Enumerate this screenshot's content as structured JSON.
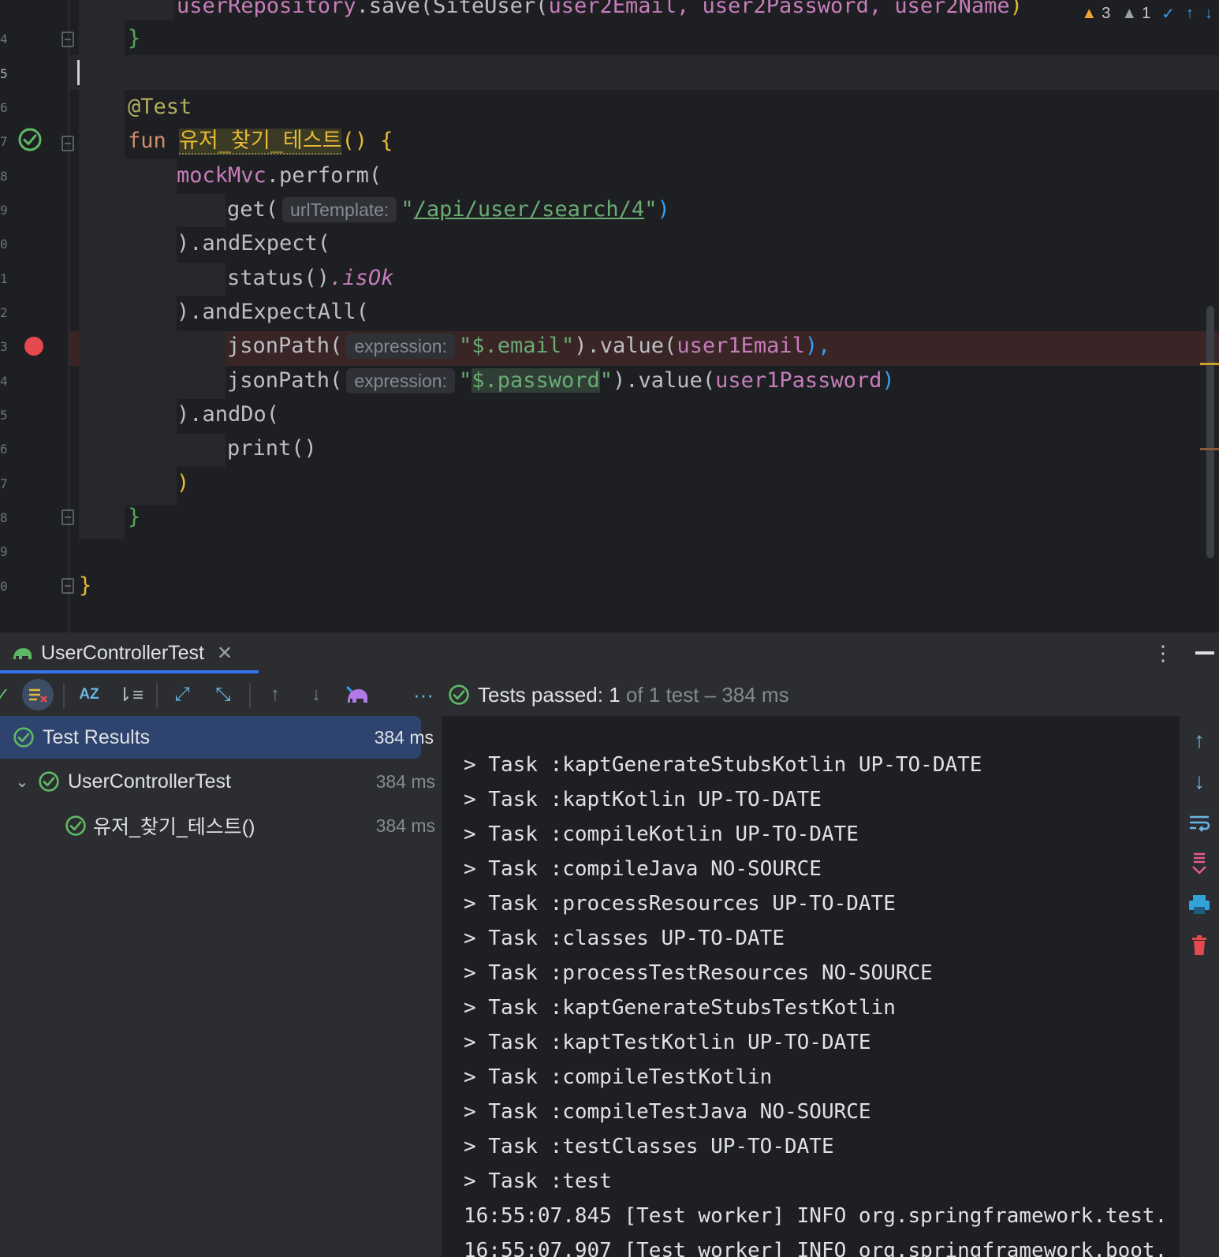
{
  "editor": {
    "top_partial": {
      "receiver": "userRepository",
      "method": ".save(",
      "ctor": "SiteUser(",
      "args": "user2Email, user2Password, user2Name",
      "close": ")"
    },
    "warnings": {
      "warn_count": "3",
      "weak_count": "1"
    },
    "lines": {
      "brace_close_1": "}",
      "annotation": "@Test",
      "fun_kw": "fun",
      "fun_name": "유저_찾기_테스트",
      "fun_sig_tail": "() {",
      "mockmvc": "mockMvc",
      "perform": ".perform(",
      "get": "get(",
      "get_hint": "urlTemplate:",
      "get_url": "/api/user/search/4",
      "get_close": ")",
      "and_expect": ").andExpect(",
      "status": "status()",
      "is_ok": ".isOk",
      "and_expect_all": ").andExpectAll(",
      "jsonpath": "jsonPath(",
      "expr_hint": "expression:",
      "email_path": "$.email",
      "email_value": ").value(",
      "email_arg": "user1Email",
      "email_end": "),",
      "password_path": "$.password",
      "password_value": ").value(",
      "password_arg": "user1Password",
      "password_end": ")",
      "and_do": ").andDo(",
      "print": "print()",
      "paren_close": ")",
      "brace_close_2": "}",
      "brace_close_class": "}"
    },
    "line_numbers": [
      "4",
      "5",
      "6",
      "7",
      "8",
      "9",
      "0",
      "1",
      "2",
      "3",
      "4",
      "5",
      "6",
      "7",
      "8",
      "9",
      "0"
    ]
  },
  "run_panel": {
    "tab_title": "UserControllerTest",
    "status_prefix": "Tests passed:",
    "status_count": "1",
    "status_suffix": "of 1 test – 384 ms",
    "tree": [
      {
        "label": "Test Results",
        "duration": "384 ms"
      },
      {
        "label": "UserControllerTest",
        "duration": "384 ms"
      },
      {
        "label": "유저_찾기_테스트()",
        "duration": "384 ms"
      }
    ],
    "console_lines": [
      "> Task :kaptGenerateStubsKotlin UP-TO-DATE",
      "> Task :kaptKotlin UP-TO-DATE",
      "> Task :compileKotlin UP-TO-DATE",
      "> Task :compileJava NO-SOURCE",
      "> Task :processResources UP-TO-DATE",
      "> Task :classes UP-TO-DATE",
      "> Task :processTestResources NO-SOURCE",
      "> Task :kaptGenerateStubsTestKotlin",
      "> Task :kaptTestKotlin UP-TO-DATE",
      "> Task :compileTestKotlin",
      "> Task :compileTestJava NO-SOURCE",
      "> Task :testClasses UP-TO-DATE",
      "> Task :test",
      "16:55:07.845 [Test worker] INFO org.springframework.test.",
      "16:55:07.907 [Test worker] INFO org.springframework.boot."
    ]
  },
  "icons": {
    "pass": "check-circle-icon",
    "breakpoint": "breakpoint-icon",
    "warning": "warning-icon"
  },
  "colors": {
    "pass": "#5fb865",
    "breakpoint": "#e5484d",
    "selection": "#2e436e",
    "accent": "#3574f0"
  }
}
